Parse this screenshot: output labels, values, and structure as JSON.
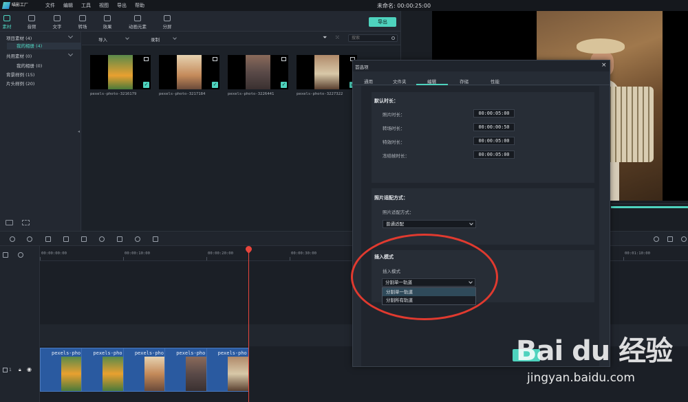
{
  "app": {
    "logo_text": "喵影工厂",
    "window_title": "未命名: 00:00:25:00"
  },
  "menubar": {
    "items": [
      "文件",
      "编辑",
      "工具",
      "视图",
      "导出",
      "帮助"
    ]
  },
  "tooltabs": {
    "items": [
      {
        "label": "素材",
        "icon": "folder-icon",
        "active": true
      },
      {
        "label": "音频",
        "icon": "music-icon"
      },
      {
        "label": "文字",
        "icon": "text-icon"
      },
      {
        "label": "转场",
        "icon": "transition-icon"
      },
      {
        "label": "效果",
        "icon": "effects-icon"
      },
      {
        "label": "动画元素",
        "icon": "elements-icon"
      },
      {
        "label": "分屏",
        "icon": "split-screen-icon"
      }
    ],
    "export_label": "导出"
  },
  "library": {
    "items": [
      {
        "label": "项目素材 (4)"
      },
      {
        "label": "我的相册 (4)"
      },
      {
        "label": "共用素材 (0)"
      },
      {
        "label": "我的相册 (0)"
      },
      {
        "label": "背景样例 (15)"
      },
      {
        "label": "片头样例 (20)"
      }
    ]
  },
  "media_toolbar": {
    "import_label": "导入",
    "record_label": "录制",
    "search_placeholder": "搜索"
  },
  "media": {
    "thumbnails": [
      {
        "name": "pexels-photo-3216179",
        "colors": [
          "#e8a030",
          "#4a7a3a"
        ]
      },
      {
        "name": "pexels-photo-3217184",
        "colors": [
          "#e6d2b0",
          "#c48a5a"
        ]
      },
      {
        "name": "pexels-photo-3226441",
        "colors": [
          "#8a6a5a",
          "#3a3030"
        ]
      },
      {
        "name": "pexels-photo-3227322",
        "colors": [
          "#b08a6a",
          "#d8c8a8"
        ]
      }
    ]
  },
  "timeline": {
    "ruler": [
      "00:00:00:00",
      "00:00:10:00",
      "00:00:20:00",
      "00:00:30:00",
      "00:01:10:00"
    ],
    "clips": [
      {
        "label": "pexels-pho",
        "colors": [
          "#e8a030",
          "#4a7a3a"
        ]
      },
      {
        "label": "pexels-pho",
        "colors": [
          "#e8a030",
          "#4a7a3a"
        ]
      },
      {
        "label": "pexels-pho",
        "colors": [
          "#e6d2b0",
          "#c48a5a"
        ]
      },
      {
        "label": "pexels-pho",
        "colors": [
          "#8a6a5a",
          "#3a3030"
        ]
      },
      {
        "label": "pexels-pho",
        "colors": [
          "#b08a6a",
          "#d8c8a8"
        ]
      }
    ],
    "track_label": "1"
  },
  "dialog": {
    "title": "首选项",
    "tabs": [
      "通用",
      "文件夹",
      "编辑",
      "存储",
      "性能"
    ],
    "active_tab": "编辑",
    "default_duration": {
      "title": "默认时长：",
      "rows": [
        {
          "label": "照片时长：",
          "value": "00:00:05:00"
        },
        {
          "label": "转场时长：",
          "value": "00:00:00:50"
        },
        {
          "label": "特效时长：",
          "value": "00:00:05:00"
        },
        {
          "label": "冻结帧时长：",
          "value": "00:00:05:00"
        }
      ]
    },
    "photo_fit": {
      "title": "照片适配方式：",
      "label": "照片适配方式：",
      "value": "普通适配"
    },
    "insert_mode": {
      "title": "插入模式",
      "label": "插入模式",
      "value": "分割单一轨道",
      "options": [
        "分割单一轨道",
        "分割所有轨道"
      ]
    }
  },
  "watermark": {
    "logo": "Bai du 经验",
    "url": "jingyan.baidu.com"
  },
  "colors": {
    "accent": "#4ed3be",
    "playhead": "#e8453c",
    "annotation": "#e03a2f"
  }
}
